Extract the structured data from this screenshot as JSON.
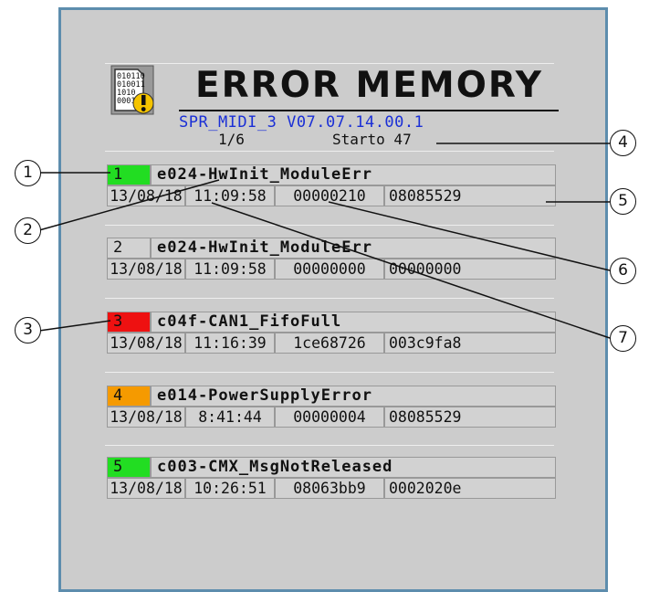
{
  "header": {
    "title": "ERROR MEMORY",
    "version": "SPR_MIDI_3  V07.07.14.00.1",
    "page": "1/6",
    "starts": "Starto 47",
    "icon": "binary-document-warning-icon",
    "icon_bits": [
      "010110",
      "010011",
      "1010",
      "0001"
    ]
  },
  "entries": [
    {
      "index": "1",
      "index_color": "#22dd22",
      "code": "e024-HwInit_ModuleErr",
      "date": "13/08/18",
      "time": "11:09:58",
      "value1": "00000210",
      "value2": "08085529"
    },
    {
      "index": "2",
      "index_color": "#d2d2d2",
      "code": "e024-HwInit_ModuleErr",
      "date": "13/08/18",
      "time": "11:09:58",
      "value1": "00000000",
      "value2": "00000000"
    },
    {
      "index": "3",
      "index_color": "#ee1111",
      "code": "c04f-CAN1_FifoFull",
      "date": "13/08/18",
      "time": "11:16:39",
      "value1": "1ce68726",
      "value2": "003c9fa8"
    },
    {
      "index": "4",
      "index_color": "#f59a00",
      "code": "e014-PowerSupplyError",
      "date": "13/08/18",
      "time": "8:41:44",
      "value1": "00000004",
      "value2": "08085529"
    },
    {
      "index": "5",
      "index_color": "#22dd22",
      "code": "c003-CMX_MsgNotReleased",
      "date": "13/08/18",
      "time": "10:26:51",
      "value1": "08063bb9",
      "value2": "0002020e"
    }
  ],
  "callouts": [
    "1",
    "2",
    "3",
    "4",
    "5",
    "6",
    "7"
  ],
  "colors": {
    "screen_bg": "#cccccc",
    "screen_border": "#5d8dad",
    "version_text": "#1a2fd6",
    "warning": "#f5c400"
  }
}
